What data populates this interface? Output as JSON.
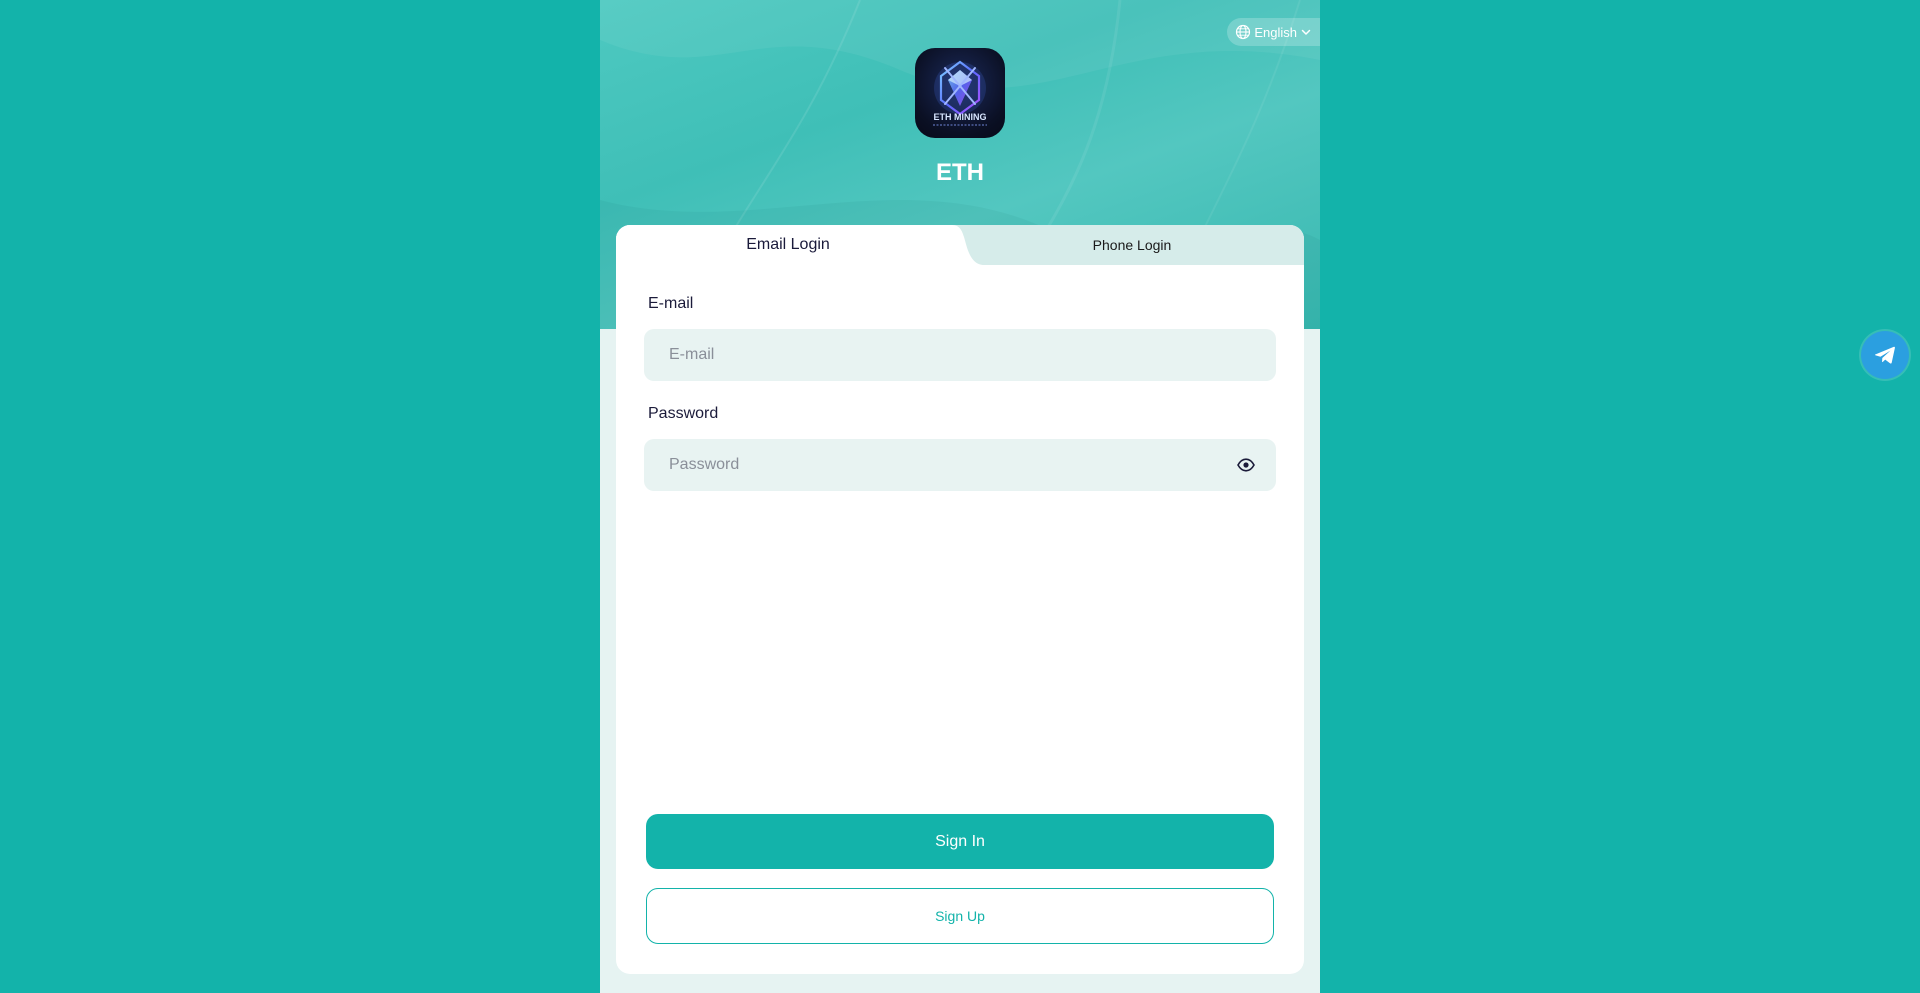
{
  "language": {
    "label": "English",
    "icon": "globe-icon",
    "chevron": "chevron-down-icon"
  },
  "brand": {
    "title": "ETH",
    "logo_text": "ETH MINING"
  },
  "tabs": [
    {
      "label": "Email Login",
      "active": true
    },
    {
      "label": "Phone Login",
      "active": false
    }
  ],
  "form": {
    "email": {
      "label": "E-mail",
      "placeholder": "E-mail",
      "value": ""
    },
    "password": {
      "label": "Password",
      "placeholder": "Password",
      "value": "",
      "toggle_icon": "eye-icon"
    }
  },
  "actions": {
    "sign_in": "Sign In",
    "sign_up": "Sign Up"
  },
  "floating": {
    "telegram_icon": "telegram-icon"
  },
  "colors": {
    "background": "#13b3aa",
    "accent": "#13b3aa",
    "input_bg": "#e8f3f2",
    "tab_inactive_bg": "#d6ecea",
    "telegram": "#2b9fe0"
  }
}
